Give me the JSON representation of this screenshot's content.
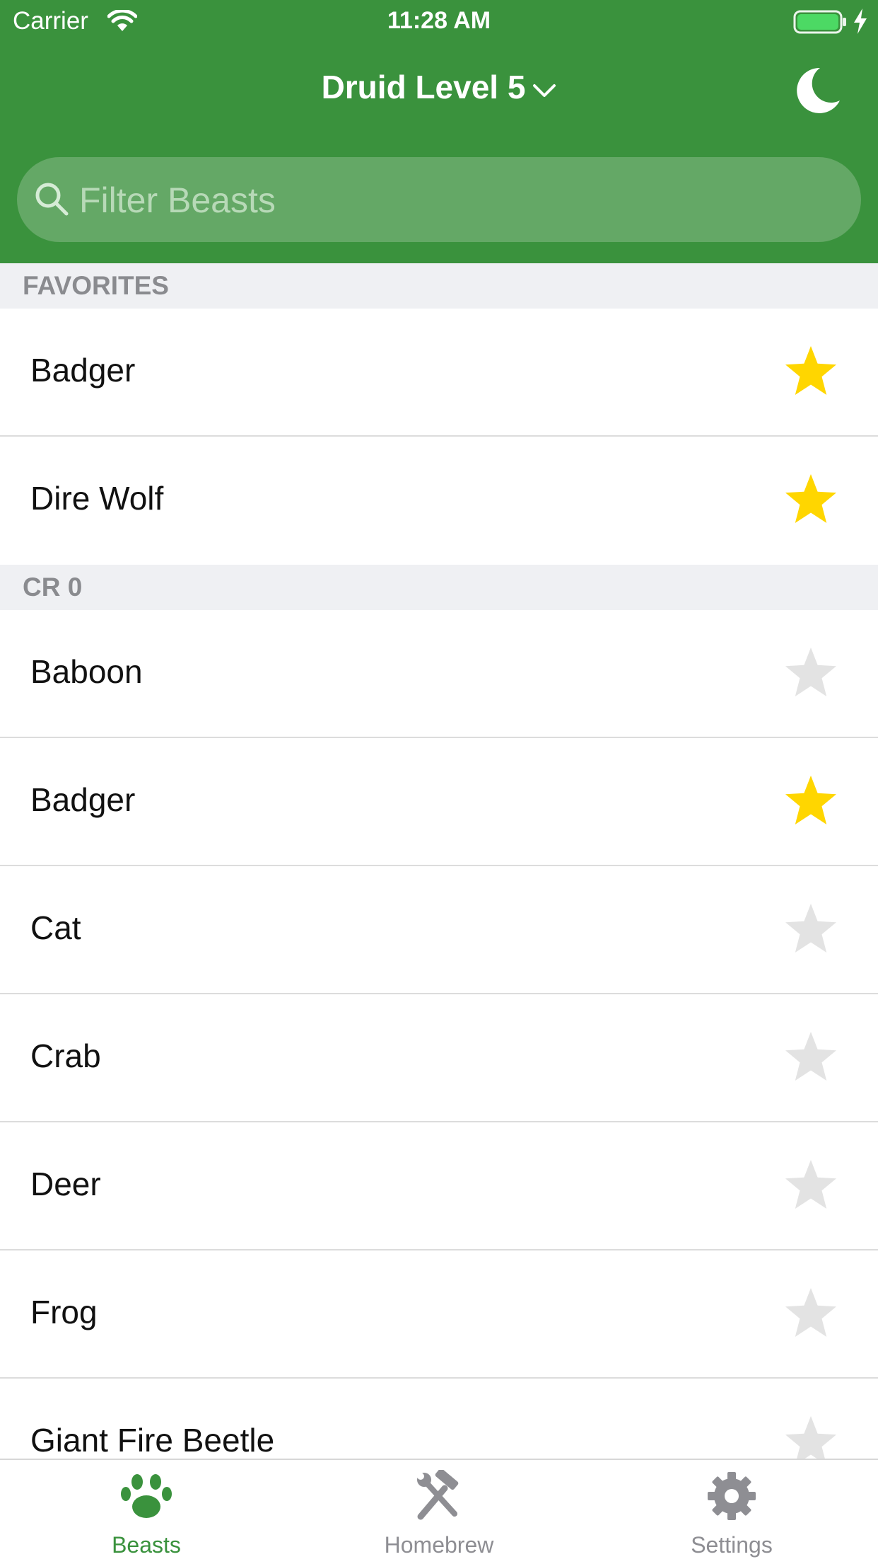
{
  "status_bar": {
    "carrier": "Carrier",
    "time": "11:28 AM"
  },
  "nav": {
    "title": "Druid Level 5",
    "title_icon": "chevron-down-icon",
    "right_icon": "moon-icon"
  },
  "search": {
    "placeholder": "Filter Beasts",
    "value": ""
  },
  "sections": [
    {
      "title": "FAVORITES",
      "rows": [
        {
          "name": "Badger",
          "favorite": true
        },
        {
          "name": "Dire Wolf",
          "favorite": true
        }
      ]
    },
    {
      "title": "CR 0",
      "rows": [
        {
          "name": "Baboon",
          "favorite": false
        },
        {
          "name": "Badger",
          "favorite": true
        },
        {
          "name": "Cat",
          "favorite": false
        },
        {
          "name": "Crab",
          "favorite": false
        },
        {
          "name": "Deer",
          "favorite": false
        },
        {
          "name": "Frog",
          "favorite": false
        },
        {
          "name": "Giant Fire Beetle",
          "favorite": false
        }
      ]
    }
  ],
  "tabs": [
    {
      "label": "Beasts",
      "icon": "paw-icon",
      "active": true
    },
    {
      "label": "Homebrew",
      "icon": "hammer-wrench-icon",
      "active": false
    },
    {
      "label": "Settings",
      "icon": "gear-icon",
      "active": false
    }
  ],
  "colors": {
    "header_green": "#3a923d",
    "search_bg": "#64a866",
    "star_active": "#ffd600",
    "star_inactive": "#e3e3e3",
    "tab_active": "#3a923d",
    "tab_inactive": "#8e8e93",
    "section_bg": "#eff0f3"
  }
}
